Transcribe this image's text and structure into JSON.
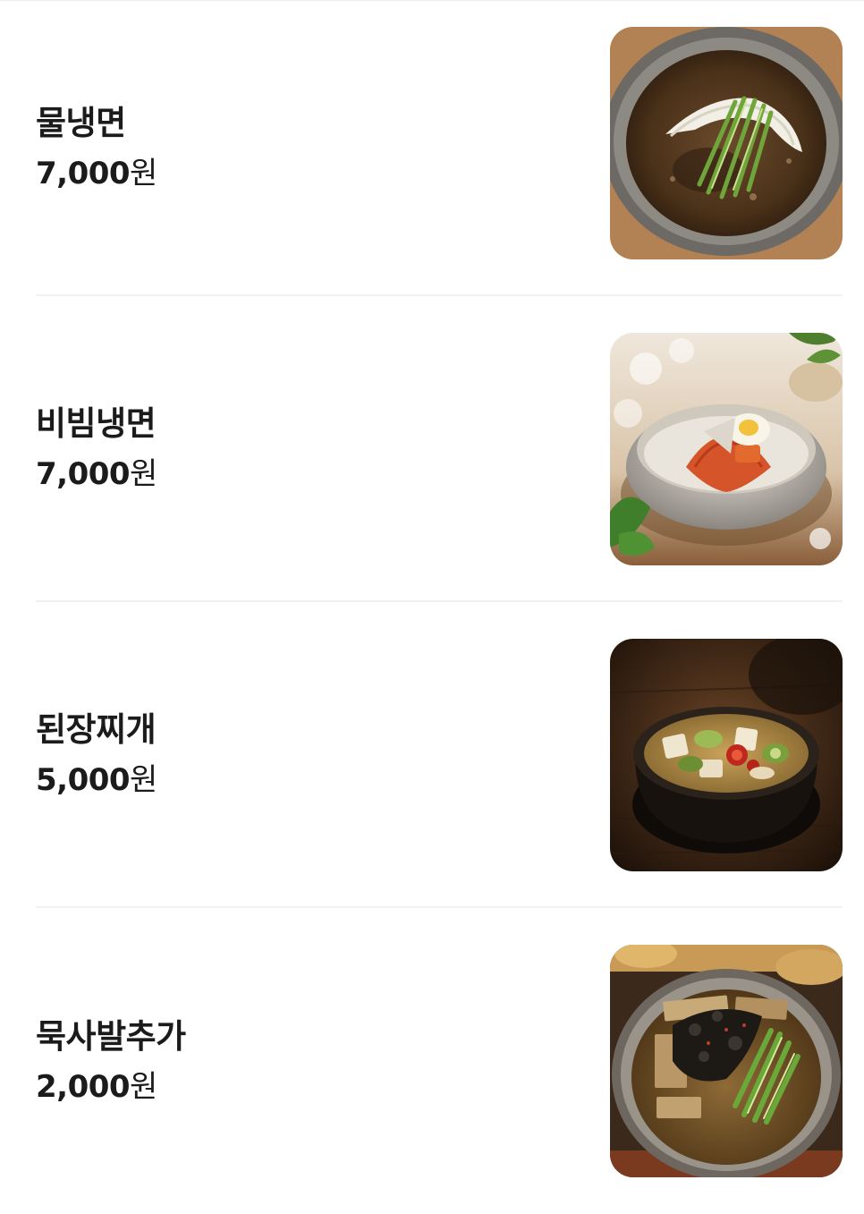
{
  "menu": {
    "items": [
      {
        "name": "물냉면",
        "price": "7,000",
        "unit": "원",
        "image": "mul-naengmyeon-photo"
      },
      {
        "name": "비빔냉면",
        "price": "7,000",
        "unit": "원",
        "image": "bibim-naengmyeon-photo"
      },
      {
        "name": "된장찌개",
        "price": "5,000",
        "unit": "원",
        "image": "doenjang-jjigae-photo"
      },
      {
        "name": "묵사발추가",
        "price": "2,000",
        "unit": "원",
        "image": "muksabal-photo"
      }
    ]
  }
}
